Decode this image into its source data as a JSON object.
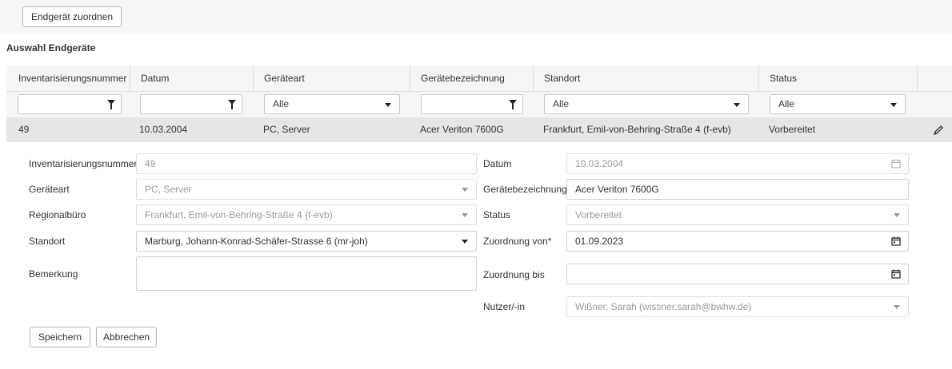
{
  "toolbar": {
    "assign_label": "Endgerät zuordnen"
  },
  "section": {
    "title": "Auswahl Endgeräte"
  },
  "grid": {
    "columns": [
      "Inventarisierungsnummer",
      "Datum",
      "Geräteart",
      "Gerätebezeichnung",
      "Standort",
      "Status"
    ],
    "filters": {
      "geraeteart": "Alle",
      "standort": "Alle",
      "status": "Alle"
    },
    "row": {
      "inventarnummer": "49",
      "datum": "10.03.2004",
      "geraeteart": "PC, Server",
      "bezeichnung": "Acer Veriton 7600G",
      "standort": "Frankfurt, Emil-von-Behring-Straße 4 (f-evb)",
      "status": "Vorbereitet"
    }
  },
  "form": {
    "labels": {
      "inventarnummer": "Inventarisierungsnummer",
      "geraeteart": "Geräteart",
      "regionalbuero": "Regionalbüro",
      "standort": "Standort",
      "bemerkung": "Bemerkung",
      "datum": "Datum",
      "bezeichnung": "Gerätebezeichnung",
      "status": "Status",
      "zuordnung_von": "Zuordnung von*",
      "zuordnung_bis": "Zuordnung bis",
      "nutzer": "Nutzer/-in"
    },
    "values": {
      "inventarnummer": "49",
      "geraeteart": "PC, Server",
      "regionalbuero": "Frankfurt, Emil-von-Behring-Straße 4 (f-evb)",
      "standort": "Marburg, Johann-Konrad-Schäfer-Strasse 6 (mr-joh)",
      "bemerkung": "",
      "datum": "10.03.2004",
      "bezeichnung": "Acer Veriton 7600G",
      "status": "Vorbereitet",
      "zuordnung_von": "01.09.2023",
      "zuordnung_bis": "",
      "nutzer": "Wißner, Sarah (wissner.sarah@bwhw.de)"
    },
    "save_label": "Speichern",
    "cancel_label": "Abbrechen"
  },
  "icons": [
    "filter-icon",
    "chevron-down-icon",
    "edit-pencil-icon",
    "calendar-icon"
  ]
}
